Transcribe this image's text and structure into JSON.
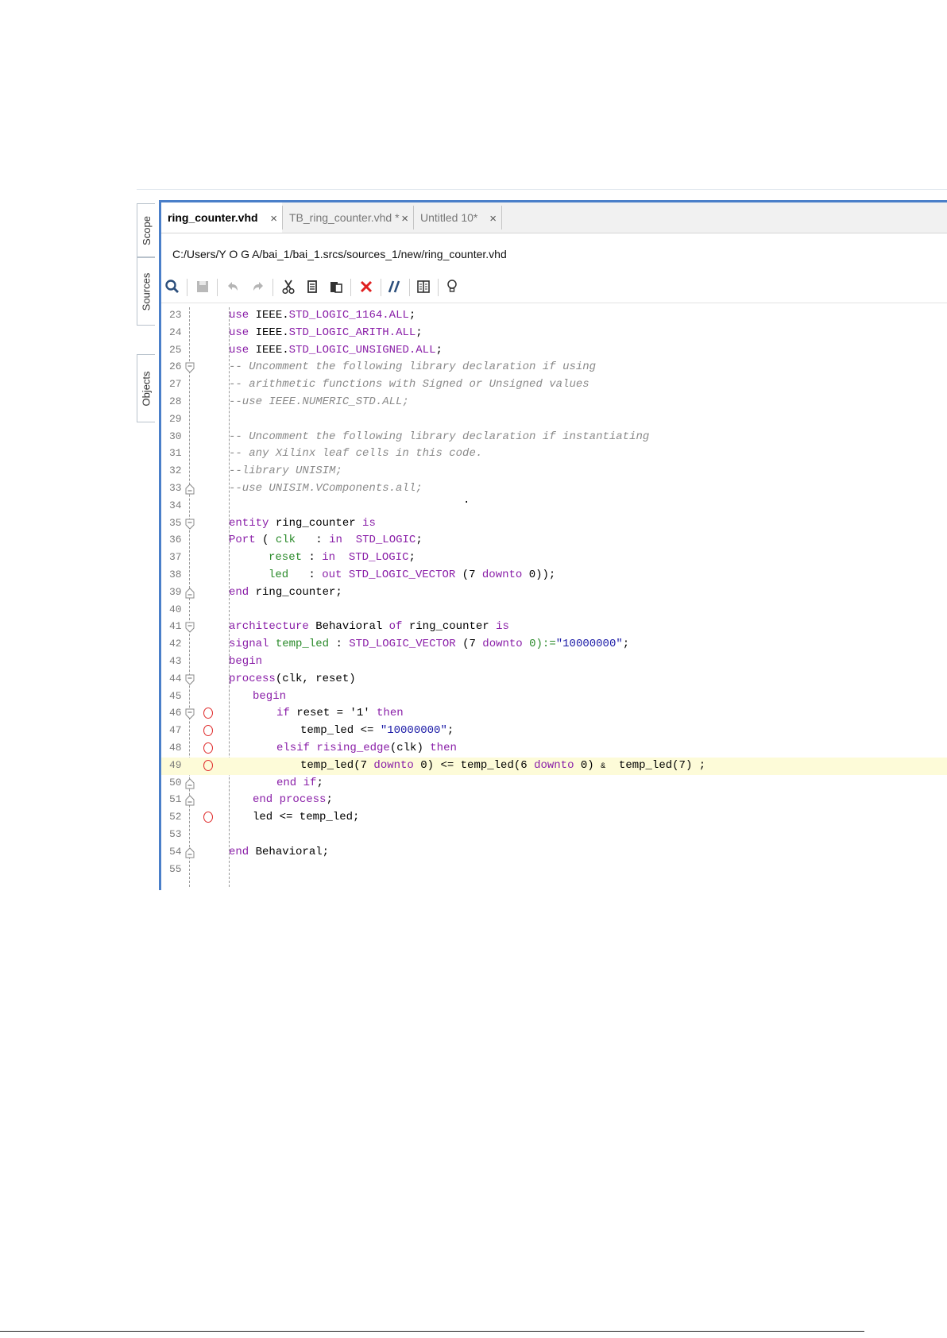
{
  "side_tabs": [
    "Scope",
    "Sources",
    "Objects"
  ],
  "tabs": [
    {
      "label": "ring_counter.vhd",
      "close": "×",
      "active": true
    },
    {
      "label": "TB_ring_counter.vhd *",
      "close": "×",
      "active": false
    },
    {
      "label": "Untitled 10*",
      "close": "×",
      "active": false
    }
  ],
  "file_path": "C:/Users/Y O G A/bai_1/bai_1.srcs/sources_1/new/ring_counter.vhd",
  "toolbar": [
    "search-icon",
    "save-icon",
    "undo-icon",
    "redo-icon",
    "cut-icon",
    "copy-icon",
    "paste-icon",
    "delete-icon",
    "comment-icon",
    "columns-icon",
    "lightbulb-icon"
  ],
  "colors": {
    "keyword": "#8a1fa8",
    "comment": "#8a8a8a",
    "string": "#1a1aa6",
    "identifier": "#2a8a2a",
    "accent": "#4a7fc9",
    "highlight": "#fdfbd8",
    "breakpoint": "#e03030"
  },
  "code": {
    "line_numbers": [
      "23",
      "24",
      "25",
      "26",
      "27",
      "28",
      "29",
      "30",
      "31",
      "32",
      "33",
      "34",
      "35",
      "36",
      "37",
      "38",
      "39",
      "40",
      "41",
      "42",
      "43",
      "44",
      "45",
      "46",
      "47",
      "48",
      "49",
      "50",
      "51",
      "52",
      "53",
      "54",
      "55"
    ],
    "l23": {
      "kw": "use",
      "rest1": " IEEE.",
      "ty": "STD_LOGIC_1164.ALL",
      "end": ";"
    },
    "l24": {
      "kw": "use",
      "rest1": " IEEE.",
      "ty": "STD_LOGIC_ARITH.ALL",
      "end": ";"
    },
    "l25": {
      "kw": "use",
      "rest1": " IEEE.",
      "ty": "STD_LOGIC_UNSIGNED.ALL",
      "end": ";"
    },
    "l26": "-- Uncomment the following library declaration if using",
    "l27": "-- arithmetic functions with Signed or Unsigned values",
    "l28": "--use IEEE.NUMERIC_STD.ALL;",
    "l30": "-- Uncomment the following library declaration if instantiating",
    "l31": "-- any Xilinx leaf cells in this code.",
    "l32": "--library UNISIM;",
    "l33": "--use UNISIM.VComponents.all;",
    "l34_dot": "·",
    "l35": {
      "kw": "entity",
      "name": " ring_counter ",
      "kw2": "is"
    },
    "l36": {
      "kw": "Port",
      "p1": " ( ",
      "id": "clk",
      "p2": "   : ",
      "mode": "in",
      "p3": "  ",
      "ty": "STD_LOGIC",
      "end": ";"
    },
    "l37": {
      "id": "reset",
      "p2": " : ",
      "mode": "in",
      "p3": "  ",
      "ty": "STD_LOGIC",
      "end": ";"
    },
    "l38": {
      "id": "led",
      "p2": "   : ",
      "mode": "out",
      "p3": " ",
      "ty": "STD_LOGIC_VECTOR",
      "p4": " (7 ",
      "kw": "downto",
      "end": " 0));"
    },
    "l39": {
      "kw": "end",
      "rest": " ring_counter;"
    },
    "l41": {
      "kw": "architecture",
      "rest1": " Behavioral ",
      "kw2": "of",
      "rest2": " ring_counter ",
      "kw3": "is"
    },
    "l42": {
      "kw": "signal",
      "sp": " ",
      "id": "temp_led",
      "p1": " : ",
      "ty": "STD_LOGIC_VECTOR",
      "p2": " (7 ",
      "kw2": "downto",
      "p3": " 0):=",
      "st": "\"10000000\"",
      "end": ";"
    },
    "l43": "begin",
    "l44": {
      "kw": "process",
      "rest": "(clk, reset)"
    },
    "l45": "begin",
    "l46": {
      "kw": "if",
      "rest": " reset = '1' ",
      "kw2": "then"
    },
    "l47": {
      "rest": "temp_led <= ",
      "st": "\"10000000\"",
      "end": ";"
    },
    "l48": {
      "kw": "elsif",
      "sp": " ",
      "fn": "rising_edge",
      "rest": "(clk) ",
      "kw2": "then"
    },
    "l49": {
      "rest1": "temp_led(7 ",
      "kw": "downto",
      "rest2": " 0) <= temp_led(6 ",
      "kw2": "downto",
      "rest3": " 0) ",
      "amp": "&",
      "rest4": "  temp_led(7) ;"
    },
    "l50": {
      "kw": "end",
      "sp": " ",
      "kw2": "if",
      "end": ";"
    },
    "l51": {
      "kw": "end",
      "sp": " ",
      "kw2": "process",
      "end": ";"
    },
    "l52": "led <= temp_led;",
    "l54": {
      "kw": "end",
      "rest": " Behavioral;"
    }
  }
}
